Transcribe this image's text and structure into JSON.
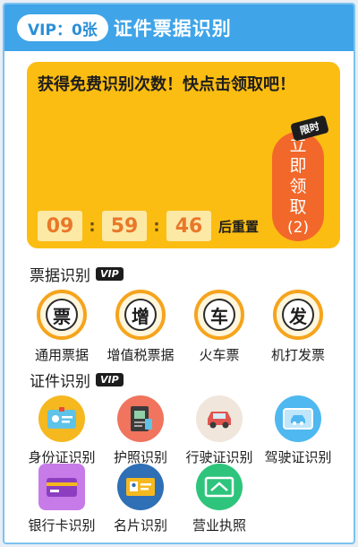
{
  "header": {
    "vip_label": "VIP：0张",
    "title": "证件票据识别"
  },
  "promo": {
    "text": "获得免费识别次数！快点击领取吧！",
    "limit_tag": "限时",
    "claim_line1": "立",
    "claim_line2": "即",
    "claim_line3": "领",
    "claim_line4": "取",
    "claim_count": "(2)",
    "countdown": {
      "hours": "09",
      "minutes": "59",
      "seconds": "46",
      "sep": ":"
    },
    "reset_label": "后重置"
  },
  "bill_section": {
    "title": "票据识别",
    "badge": "VIP",
    "items": [
      {
        "label": "通用票据",
        "glyph": "票",
        "icon": "general-bill-icon"
      },
      {
        "label": "增值税票据",
        "glyph": "增",
        "icon": "vat-invoice-icon"
      },
      {
        "label": "火车票",
        "glyph": "车",
        "icon": "train-ticket-icon"
      },
      {
        "label": "机打发票",
        "glyph": "发",
        "icon": "printed-invoice-icon"
      }
    ]
  },
  "id_section": {
    "title": "证件识别",
    "badge": "VIP",
    "items": [
      {
        "label": "身份证识别",
        "icon": "id-card-icon",
        "color": "#f5b81f"
      },
      {
        "label": "护照识别",
        "icon": "passport-icon",
        "color": "#f0745e"
      },
      {
        "label": "行驶证识别",
        "icon": "car-license-icon",
        "color": "#f0e6dc"
      },
      {
        "label": "驾驶证识别",
        "icon": "driver-license-icon",
        "color": "#4fb8f0"
      },
      {
        "label": "银行卡识别",
        "icon": "bank-card-icon",
        "color": "#c77be8"
      },
      {
        "label": "名片识别",
        "icon": "business-card-icon",
        "color": "#2f6fb5"
      },
      {
        "label": "营业执照",
        "icon": "business-license-icon",
        "color": "#2ec47c"
      }
    ]
  }
}
